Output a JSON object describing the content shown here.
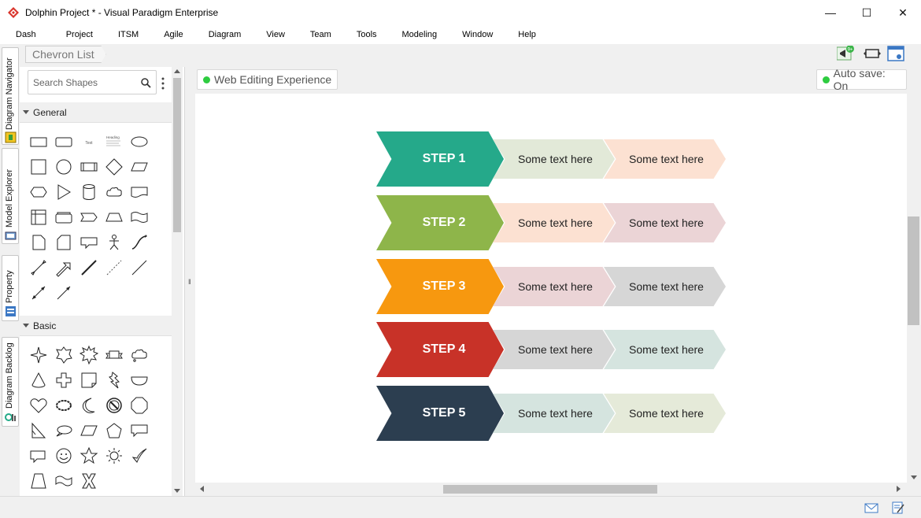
{
  "window": {
    "title": "Dolphin Project * - Visual Paradigm Enterprise",
    "minimize": "—",
    "maximize": "☐",
    "close": "✕"
  },
  "menu": [
    "Dash",
    "Project",
    "ITSM",
    "Agile",
    "Diagram",
    "View",
    "Team",
    "Tools",
    "Modeling",
    "Window",
    "Help"
  ],
  "side_tabs": [
    "Diagram Navigator",
    "Model Explorer",
    "Property",
    "Diagram Backlog"
  ],
  "breadcrumb": "Chevron List",
  "toolbar": {
    "notification_badge": "9+"
  },
  "shape_panel": {
    "search_placeholder": "Search Shapes",
    "sections": [
      {
        "name": "General"
      },
      {
        "name": "Basic"
      }
    ],
    "general_text_label": "Text",
    "general_heading_label": "Heading"
  },
  "canvas": {
    "web_editing": "Web Editing Experience",
    "autosave": "Auto save: On",
    "steps": [
      {
        "label": "STEP 1",
        "color": "#25a98a",
        "texts": [
          "Some text here",
          "Some text here"
        ],
        "sub_colors": [
          "#e2e9d8",
          "#fce1d2"
        ]
      },
      {
        "label": "STEP 2",
        "color": "#8eb54a",
        "texts": [
          "Some text here",
          "Some text here"
        ],
        "sub_colors": [
          "#fce1d2",
          "#ebd4d6"
        ]
      },
      {
        "label": "STEP 3",
        "color": "#f7980f",
        "texts": [
          "Some text here",
          "Some text here"
        ],
        "sub_colors": [
          "#ebd4d6",
          "#d6d6d6"
        ]
      },
      {
        "label": "STEP 4",
        "color": "#c83228",
        "texts": [
          "Some text here",
          "Some text here"
        ],
        "sub_colors": [
          "#d6d6d6",
          "#d5e4df"
        ]
      },
      {
        "label": "STEP 5",
        "color": "#2c3e50",
        "texts": [
          "Some text here",
          "Some text here"
        ],
        "sub_colors": [
          "#d5e4df",
          "#e5ead9"
        ]
      }
    ]
  }
}
